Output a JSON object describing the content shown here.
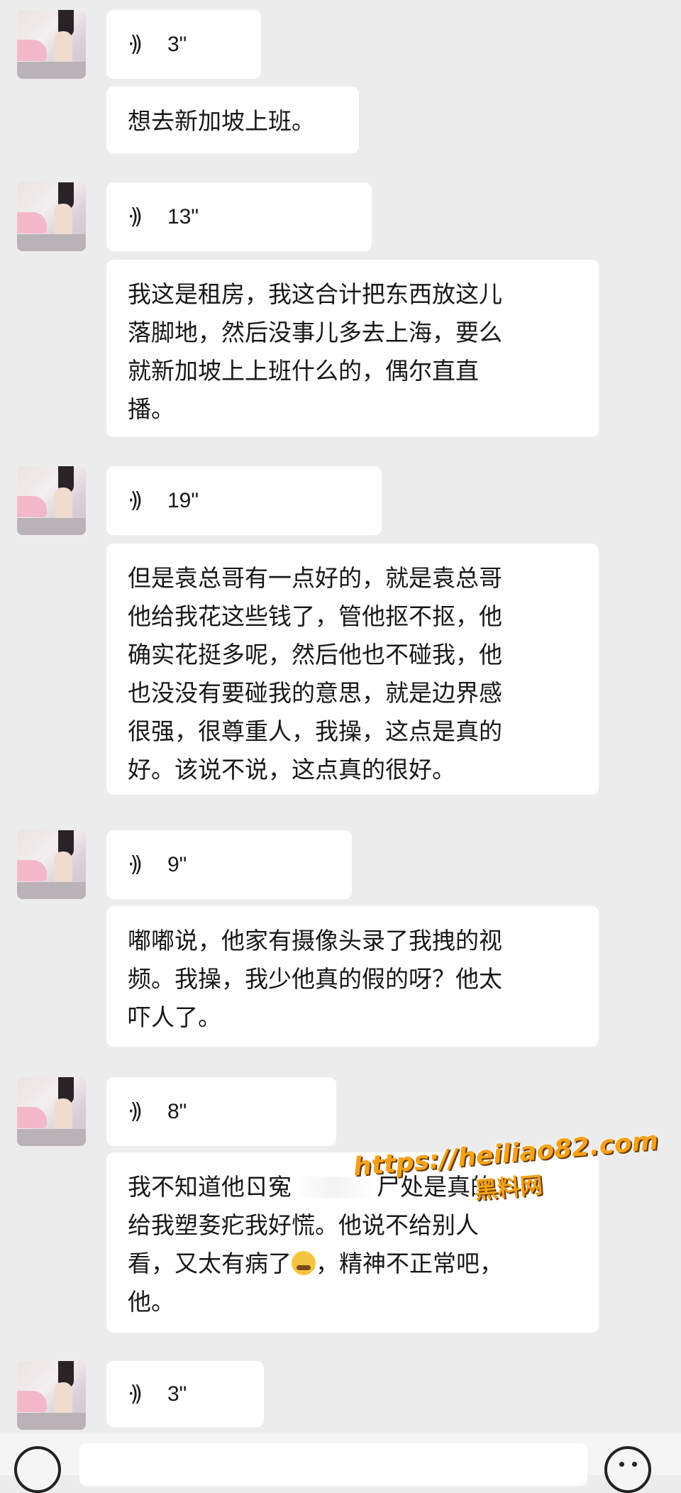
{
  "messages": [
    {
      "type": "voice",
      "duration": "3\""
    },
    {
      "type": "text",
      "lines": [
        "想去新加坡上班。"
      ]
    },
    {
      "type": "voice",
      "duration": "13\""
    },
    {
      "type": "text",
      "lines": [
        "我这是租房，我这合计把东西放这儿",
        "落脚地，然后没事儿多去上海，要么",
        "就新加坡上上班什么的，偶尔直直",
        "播。"
      ]
    },
    {
      "type": "voice",
      "duration": "19\""
    },
    {
      "type": "text",
      "lines": [
        "但是袁总哥有一点好的，就是袁总哥",
        "他给我花这些钱了，管他抠不抠，他",
        "确实花挺多呢，然后他也不碰我，他",
        "也没没有要碰我的意思，就是边界感",
        "很强，很尊重人，我操，这点是真的",
        "好。该说不说，这点真的很好。"
      ]
    },
    {
      "type": "voice",
      "duration": "9\""
    },
    {
      "type": "text",
      "lines": [
        "嘟嘟说，他家有摄像头录了我拽的视",
        "频。我操，我少他真的假的呀？他太",
        "吓人了。"
      ]
    },
    {
      "type": "voice",
      "duration": "8\""
    },
    {
      "type": "text",
      "line1_a": "我不知道他ㄖ寃",
      "line1_b": "尸处是真的",
      "line2": "给我塑㚣疕我好慌。他说不给别人",
      "line3_a": "看，又太有病了",
      "line3_b": "，精神不正常吧，",
      "line4": "他。"
    },
    {
      "type": "voice",
      "duration": "3\""
    }
  ],
  "icons": {
    "voice_wave": "voice-wave-icon",
    "sad_emoji": "crying-face-emoji-icon",
    "input_voice": "voice-mode-icon",
    "input_emoji": "emoji-smiley-icon"
  },
  "watermark": {
    "url": "https://heiliao82.com",
    "name": "黑料网"
  },
  "colors": {
    "background": "#ececec",
    "bubble": "#ffffff",
    "watermark": "#f4a21a"
  }
}
